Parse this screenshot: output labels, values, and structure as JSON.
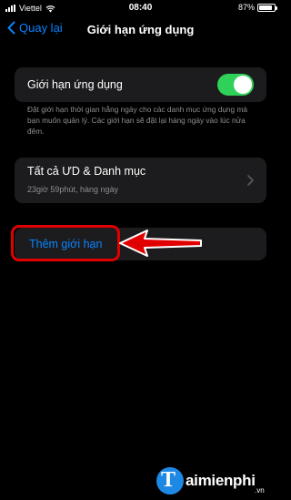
{
  "status": {
    "carrier": "Viettel",
    "time": "08:40",
    "battery": "87%",
    "battery_level": 0.87
  },
  "nav": {
    "back_label": "Quay lại",
    "title": "Giới hạn ứng dụng"
  },
  "toggle_row": {
    "label": "Giới hạn ứng dụng",
    "on": true
  },
  "footnote": "Đặt giới hạn thời gian hằng ngày cho các danh mục ứng dụng mà bạn muốn quản lý. Các giới hạn sẽ đặt lại hàng ngày vào lúc nửa đêm.",
  "apps_row": {
    "title": "Tất cả ƯD & Danh mục",
    "subtitle": "23giờ 59phút, hàng ngày"
  },
  "add_row": {
    "label": "Thêm giới hạn"
  },
  "colors": {
    "accent": "#0a84ff",
    "toggle_on": "#30d158",
    "annotation": "#e00000",
    "cell_bg": "#1c1c1e"
  },
  "watermark": {
    "brand": "aimienphi",
    "suffix": ".vn"
  }
}
